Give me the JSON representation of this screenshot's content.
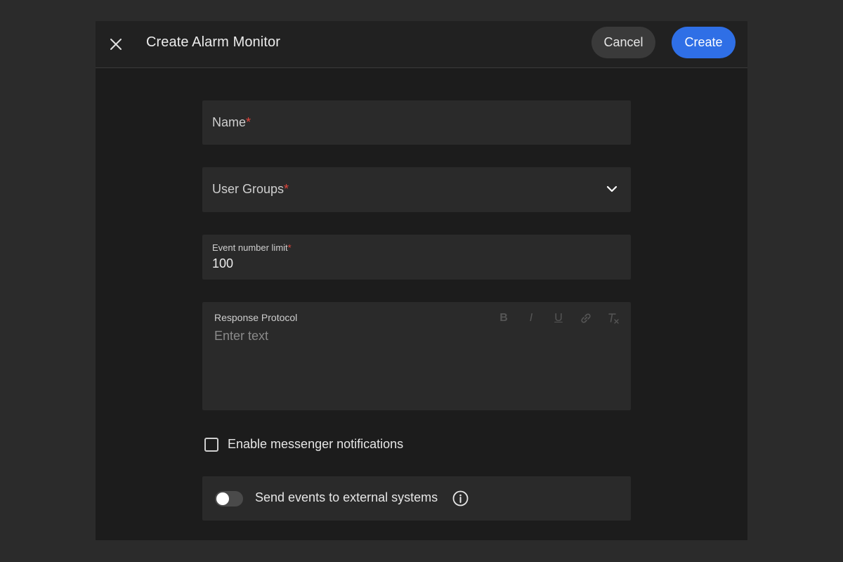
{
  "header": {
    "title": "Create Alarm Monitor",
    "cancel_label": "Cancel",
    "create_label": "Create"
  },
  "form": {
    "name": {
      "label": "Name",
      "required_mark": "*"
    },
    "user_groups": {
      "label": "User Groups",
      "required_mark": "*"
    },
    "event_limit": {
      "label": "Event number limit",
      "required_mark": "*",
      "value": "100"
    },
    "response_protocol": {
      "label": "Response Protocol",
      "placeholder": "Enter text",
      "toolbar": [
        "B",
        "I",
        "U",
        "link",
        "Tx"
      ]
    },
    "messenger": {
      "label": "Enable messenger notifications",
      "checked": false
    },
    "external": {
      "label": "Send events to external systems",
      "enabled": false
    }
  },
  "colors": {
    "accent": "#2f6fe6",
    "required": "#e0453c",
    "background": "#1c1c1c"
  },
  "icons": {
    "close": "close-icon",
    "chevron": "chevron-down-icon",
    "info": "info-icon"
  }
}
